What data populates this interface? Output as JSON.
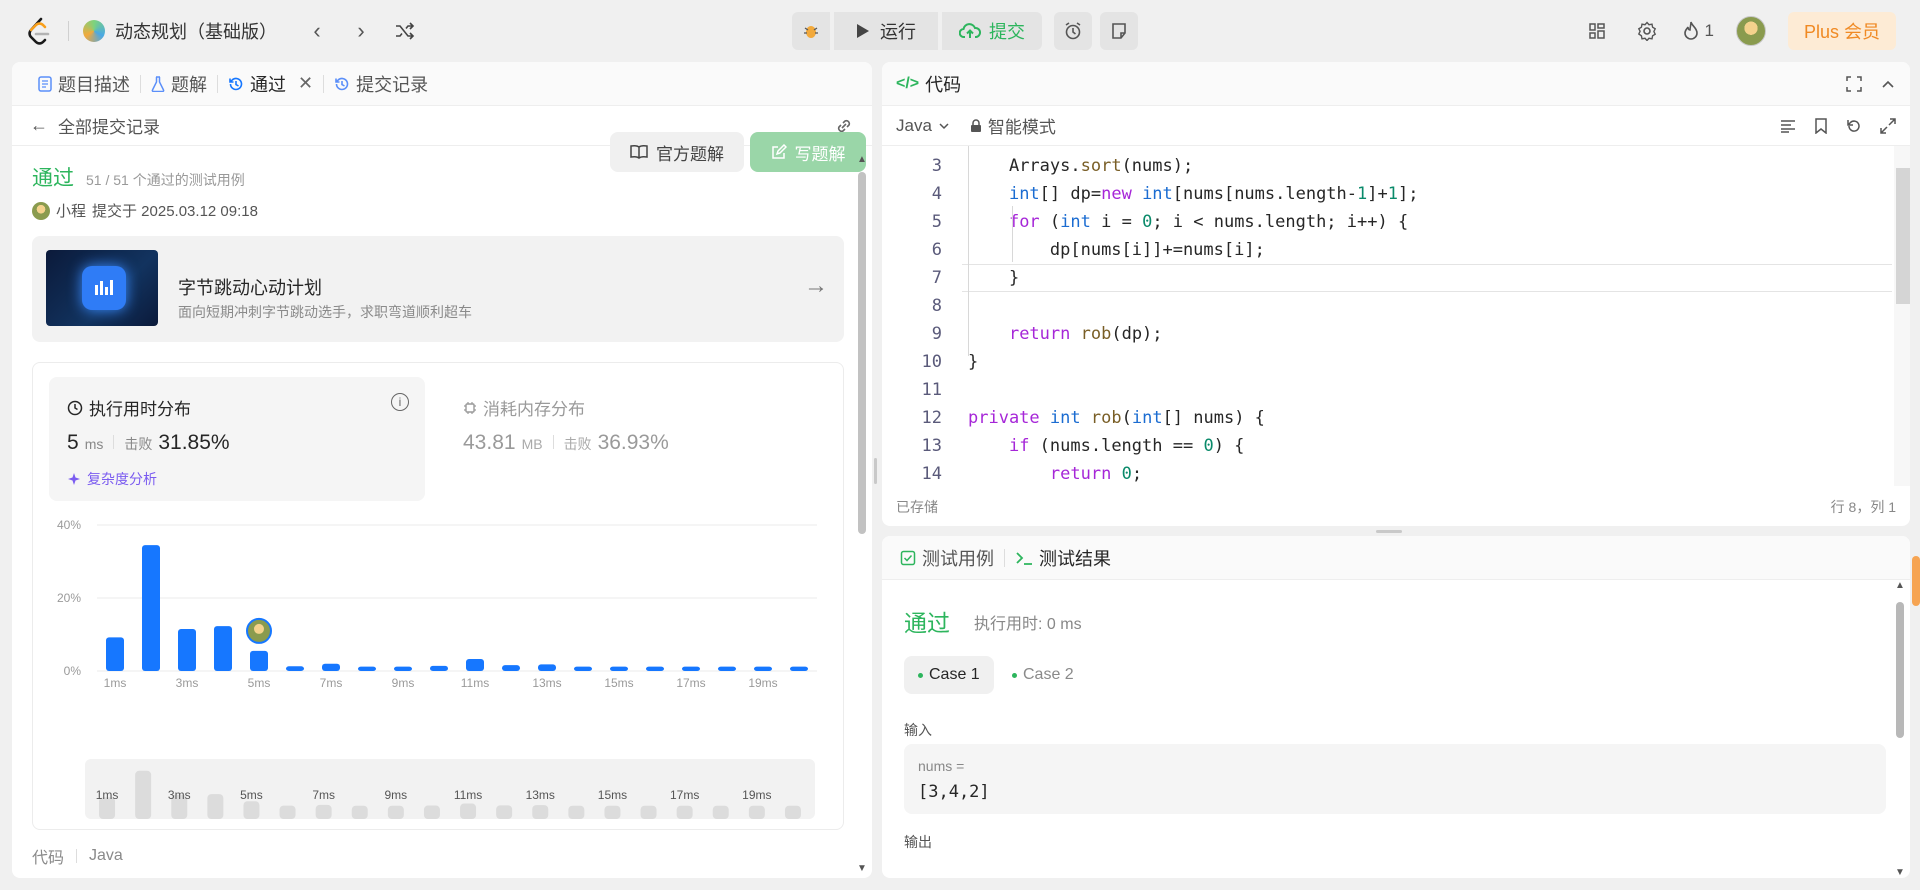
{
  "topbar": {
    "problem_list": "动态规划（基础版）",
    "run_label": "运行",
    "submit_label": "提交",
    "streak_count": "1",
    "plus_label": "Plus 会员"
  },
  "left": {
    "tabs": [
      {
        "label": "题目描述"
      },
      {
        "label": "题解"
      },
      {
        "label": "通过"
      },
      {
        "label": "提交记录"
      }
    ],
    "back_label": "全部提交记录",
    "status": "通过",
    "testcases": "51 / 51 个通过的测试用例",
    "submitter": "小程",
    "submitted_at": "提交于 2025.03.12 09:18",
    "official_solution": "官方题解",
    "write_solution": "写题解",
    "banner": {
      "title": "字节跳动心动计划",
      "subtitle": "面向短期冲刺字节跳动选手，求职弯道顺利超车"
    },
    "runtime": {
      "title": "执行用时分布",
      "value": "5",
      "unit": "ms",
      "beat_label": "击败",
      "beat_value": "31.85%",
      "analysis_link": "复杂度分析"
    },
    "memory": {
      "title": "消耗内存分布",
      "value": "43.81",
      "unit": "MB",
      "beat_label": "击败",
      "beat_value": "36.93%"
    },
    "code_label": "代码",
    "code_lang": "Java"
  },
  "chart_data": {
    "type": "bar",
    "categories": [
      "1ms",
      "2ms",
      "3ms",
      "4ms",
      "5ms",
      "6ms",
      "7ms",
      "8ms",
      "9ms",
      "10ms",
      "11ms",
      "12ms",
      "13ms",
      "14ms",
      "15ms",
      "16ms",
      "17ms",
      "18ms",
      "19ms",
      "20ms"
    ],
    "tick_labels": [
      "1ms",
      "3ms",
      "5ms",
      "7ms",
      "9ms",
      "11ms",
      "13ms",
      "15ms",
      "17ms",
      "19ms"
    ],
    "values": [
      9.2,
      34.5,
      11.5,
      12.3,
      5.5,
      1.3,
      2.0,
      1.2,
      1.2,
      1.4,
      3.3,
      1.6,
      1.8,
      1.2,
      1.2,
      1.2,
      1.2,
      1.2,
      1.2,
      1.2
    ],
    "ylim": [
      0,
      40
    ],
    "y_ticks": [
      "0%",
      "20%",
      "40%"
    ],
    "highlight_category": "5ms",
    "color": "#1677ff",
    "grid": true
  },
  "code": {
    "header": "代码",
    "language": "Java",
    "mode": "智能模式",
    "saved": "已存储",
    "cursor": "行 8，列 1",
    "lines": [
      {
        "n": "3",
        "html": "    <span class='pl'>Arrays.</span><span class='fn'>sort</span><span class='pl'>(nums);</span>"
      },
      {
        "n": "4",
        "html": "    <span class='ty'>int</span><span class='pl'>[] dp=</span><span class='kw'>new</span> <span class='ty'>int</span><span class='pl'>[nums[nums.length-</span><span class='nm'>1</span><span class='pl'>]+</span><span class='nm'>1</span><span class='pl'>];</span>"
      },
      {
        "n": "5",
        "html": "    <span class='kw'>for</span><span class='pl'> (</span><span class='ty'>int</span><span class='pl'> i = </span><span class='nm'>0</span><span class='pl'>; i &lt; nums.length; i++) {</span>"
      },
      {
        "n": "6",
        "html": "        <span class='pl'>dp[nums[i]]+=nums[i];</span>"
      },
      {
        "n": "7",
        "html": "    <span class='pl'>}</span>"
      },
      {
        "n": "8",
        "html": ""
      },
      {
        "n": "9",
        "html": "    <span class='kw'>return</span> <span class='fn'>rob</span><span class='pl'>(dp);</span>"
      },
      {
        "n": "10",
        "html": "<span class='pl'>}</span>"
      },
      {
        "n": "11",
        "html": ""
      },
      {
        "n": "12",
        "html": "<span class='kw'>private</span> <span class='ty'>int</span> <span class='fn'>rob</span><span class='pl'>(</span><span class='ty'>int</span><span class='pl'>[] nums) {</span>"
      },
      {
        "n": "13",
        "html": "    <span class='kw'>if</span><span class='pl'> (nums.length == </span><span class='nm'>0</span><span class='pl'>) {</span>"
      },
      {
        "n": "14",
        "html": "        <span class='kw'>return</span> <span class='nm'>0</span><span class='pl'>;</span>"
      }
    ]
  },
  "test": {
    "tab_cases": "测试用例",
    "tab_result": "测试结果",
    "status": "通过",
    "runtime": "执行用时: 0 ms",
    "case1": "Case 1",
    "case2": "Case 2",
    "input_label": "输入",
    "input_name": "nums =",
    "input_value": "[3,4,2]",
    "output_label": "输出"
  }
}
